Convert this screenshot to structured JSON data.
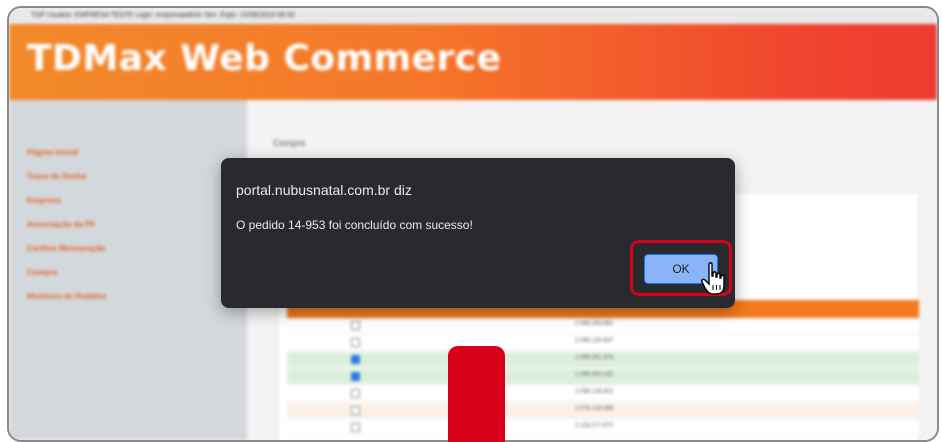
{
  "app": {
    "title": "TDMax Web Commerce",
    "topbar_text": "TDP   Usuário: EMPRESA TESTE   Login: empresaadmin   Ses. Expir: 22/08/2024 09:33"
  },
  "sidebar": {
    "items": [
      {
        "label": "Página Inicial"
      },
      {
        "label": "Troca de Senha"
      },
      {
        "label": "Empresa"
      },
      {
        "label": "Associação da PF"
      },
      {
        "label": "Cartões Mensuração"
      },
      {
        "label": "Compra"
      },
      {
        "label": "Histórico de Pedidos"
      }
    ]
  },
  "main": {
    "breadcrumb": "Compra",
    "rows": [
      {
        "value": "2.086.359.662",
        "checked": false,
        "color": "#ffffff"
      },
      {
        "value": "2.086.130.637",
        "checked": false,
        "color": "#ffffff"
      },
      {
        "value": "2.069.351.876",
        "checked": true,
        "color": "#dcefdc"
      },
      {
        "value": "2.095.400.291",
        "checked": true,
        "color": "#dcefdc"
      },
      {
        "value": "2.095.138.601",
        "checked": false,
        "color": "#ffffff"
      },
      {
        "value": "2.076.128.988",
        "checked": false,
        "color": "#fdf1e6"
      },
      {
        "value": "2.118.277.670",
        "checked": false,
        "color": "#ffffff"
      }
    ]
  },
  "dialog": {
    "origin": "portal.nubusnatal.com.br diz",
    "message": "O pedido 14-953 foi concluído com sucesso!",
    "ok_label": "OK"
  },
  "colors": {
    "accent": "#f37a1d",
    "highlight": "#d9001b",
    "dialog_bg": "#292a2d",
    "ok_button": "#8ab4f8"
  }
}
